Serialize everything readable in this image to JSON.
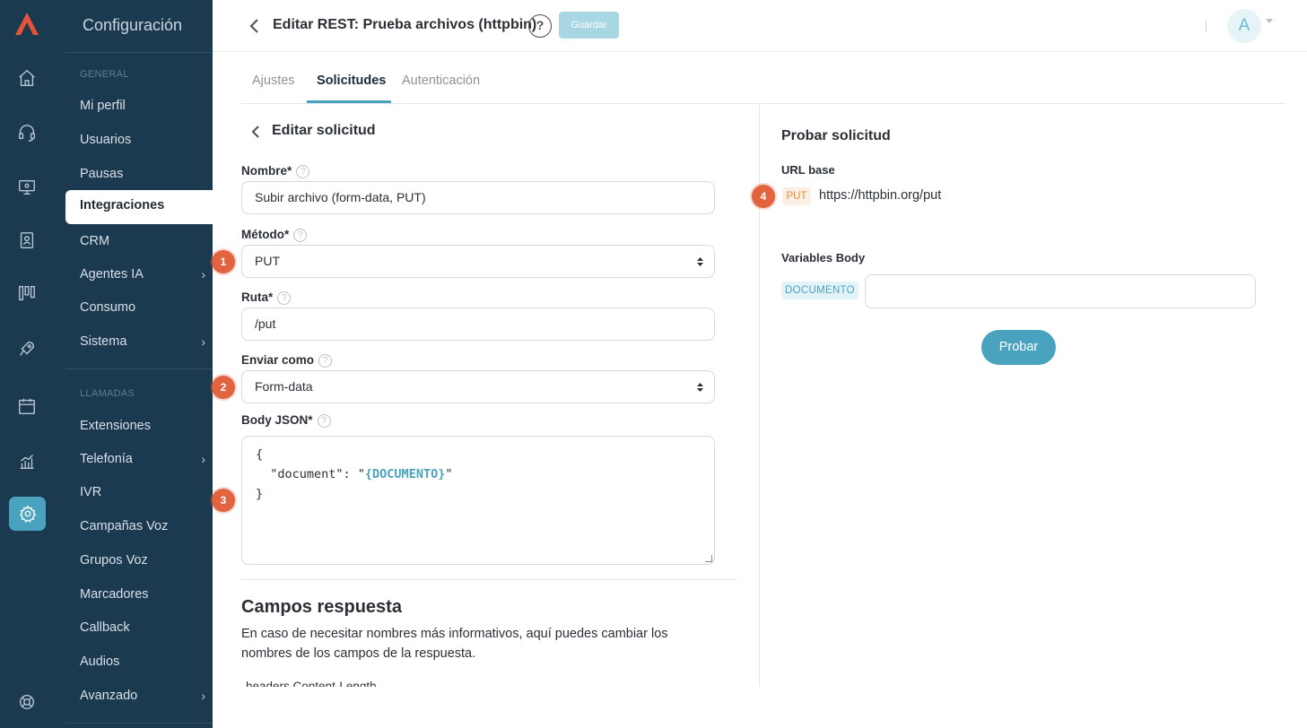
{
  "nav": {
    "title": "Configuración",
    "sections": {
      "general": "GENERAL",
      "llamadas": "LLAMADAS"
    },
    "items": [
      {
        "label": "Mi perfil"
      },
      {
        "label": "Usuarios"
      },
      {
        "label": "Pausas"
      },
      {
        "label": "Integraciones",
        "active": true
      },
      {
        "label": "CRM"
      },
      {
        "label": "Agentes IA",
        "chevron": "›"
      },
      {
        "label": "Consumo"
      },
      {
        "label": "Sistema",
        "chevron": "›"
      },
      {
        "label": "Extensiones"
      },
      {
        "label": "Telefonía",
        "chevron": "›"
      },
      {
        "label": "IVR"
      },
      {
        "label": "Campañas Voz"
      },
      {
        "label": "Grupos Voz"
      },
      {
        "label": "Marcadores"
      },
      {
        "label": "Callback"
      },
      {
        "label": "Audios"
      },
      {
        "label": "Avanzado",
        "chevron": "›"
      }
    ],
    "rail_icons": [
      "home-icon",
      "headset-icon",
      "monitor-icon",
      "contacts-icon",
      "board-icon",
      "rocket-icon",
      "calendar-icon",
      "stats-icon",
      "settings-icon",
      "support-icon"
    ]
  },
  "header": {
    "title": "Editar REST: Prueba archivos (httpbin)",
    "help": "?",
    "save_label": "Guardar",
    "avatar_initial": "A"
  },
  "tabs": [
    {
      "label": "Ajustes"
    },
    {
      "label": "Solicitudes",
      "active": true
    },
    {
      "label": "Autenticación"
    }
  ],
  "form": {
    "section_title": "Editar solicitud",
    "help_glyph": "?",
    "nombre_label": "Nombre*",
    "nombre_value": "Subir archivo (form-data, PUT)",
    "metodo_label": "Método*",
    "metodo_value": "PUT",
    "ruta_label": "Ruta*",
    "ruta_value": "/put",
    "enviar_label": "Enviar como",
    "enviar_value": "Form-data",
    "body_label": "Body JSON*",
    "body_line1": "{",
    "body_line2_prefix": "  \"document\": \"",
    "body_line2_var": "{DOCUMENTO}",
    "body_line2_suffix": "\"",
    "body_line3": "}",
    "campos_title": "Campos respuesta",
    "campos_desc": "En caso de necesitar nombres más informativos, aquí puedes cambiar los nombres de los campos de la respuesta.",
    "partial_label": "headers.Content-Length"
  },
  "markers": [
    "1",
    "2",
    "3",
    "4"
  ],
  "test": {
    "title": "Probar solicitud",
    "url_label": "URL base",
    "method": "PUT",
    "url": "https://httpbin.org/put",
    "vars_label": "Variables Body",
    "var_name": "DOCUMENTO",
    "var_value": "",
    "probar_label": "Probar"
  },
  "colors": {
    "sidebar_bg": "#1b3a50",
    "accent": "#4aa3be",
    "marker": "#e2633f",
    "method_badge_bg": "#fcefe3",
    "method_badge_text": "#e58a3d"
  }
}
